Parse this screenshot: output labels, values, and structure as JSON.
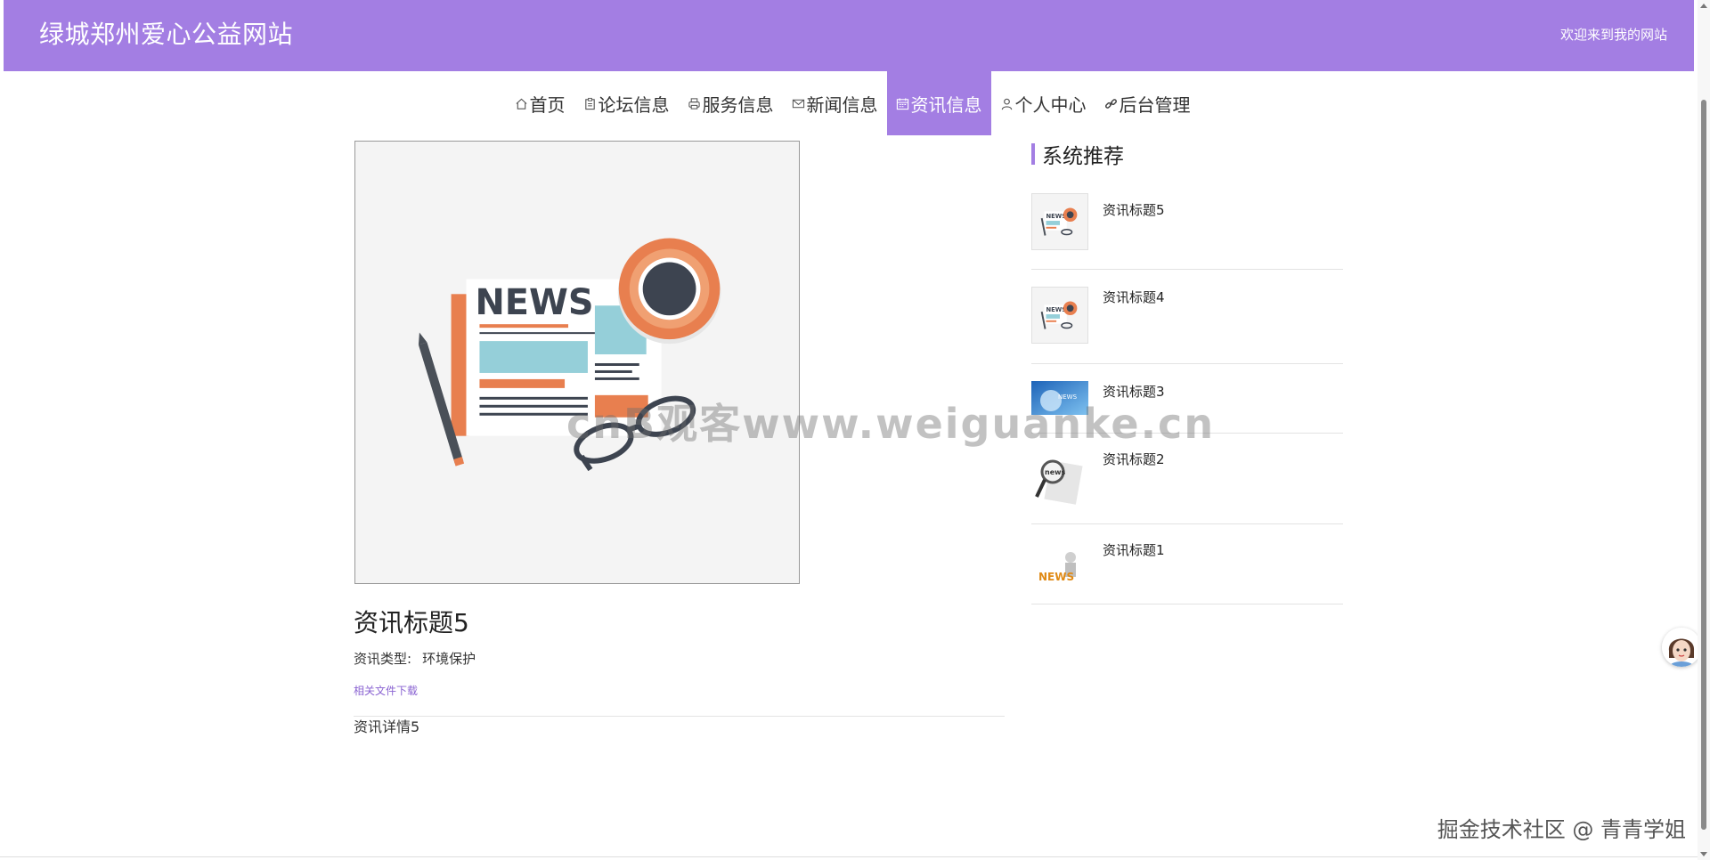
{
  "header": {
    "site_title": "绿城郑州爱心公益网站",
    "welcome": "欢迎来到我的网站",
    "bg_color": "#a37ee3"
  },
  "nav": {
    "items": [
      {
        "label": "首页",
        "icon": "home-icon"
      },
      {
        "label": "论坛信息",
        "icon": "clipboard-icon"
      },
      {
        "label": "服务信息",
        "icon": "printer-icon"
      },
      {
        "label": "新闻信息",
        "icon": "mail-icon"
      },
      {
        "label": "资讯信息",
        "icon": "calendar-icon",
        "active": true
      },
      {
        "label": "个人中心",
        "icon": "user-icon"
      },
      {
        "label": "后台管理",
        "icon": "link-icon"
      }
    ]
  },
  "detail": {
    "title": "资讯标题5",
    "type_label": "资讯类型:",
    "type_value": "环境保护",
    "download_link": "相关文件下载",
    "body": "资讯详情5"
  },
  "sidebar": {
    "heading": "系统推荐",
    "items": [
      {
        "title": "资讯标题5",
        "thumb": "news-paper-thumb"
      },
      {
        "title": "资讯标题4",
        "thumb": "news-paper-thumb"
      },
      {
        "title": "资讯标题3",
        "thumb": "globe-news-thumb"
      },
      {
        "title": "资讯标题2",
        "thumb": "magnifier-news-thumb"
      },
      {
        "title": "资讯标题1",
        "thumb": "news-3d-thumb"
      }
    ]
  },
  "watermark": "cnB观客www.weiguanke.cn",
  "corner_mark": "掘金技术社区 @ 青青学姐"
}
